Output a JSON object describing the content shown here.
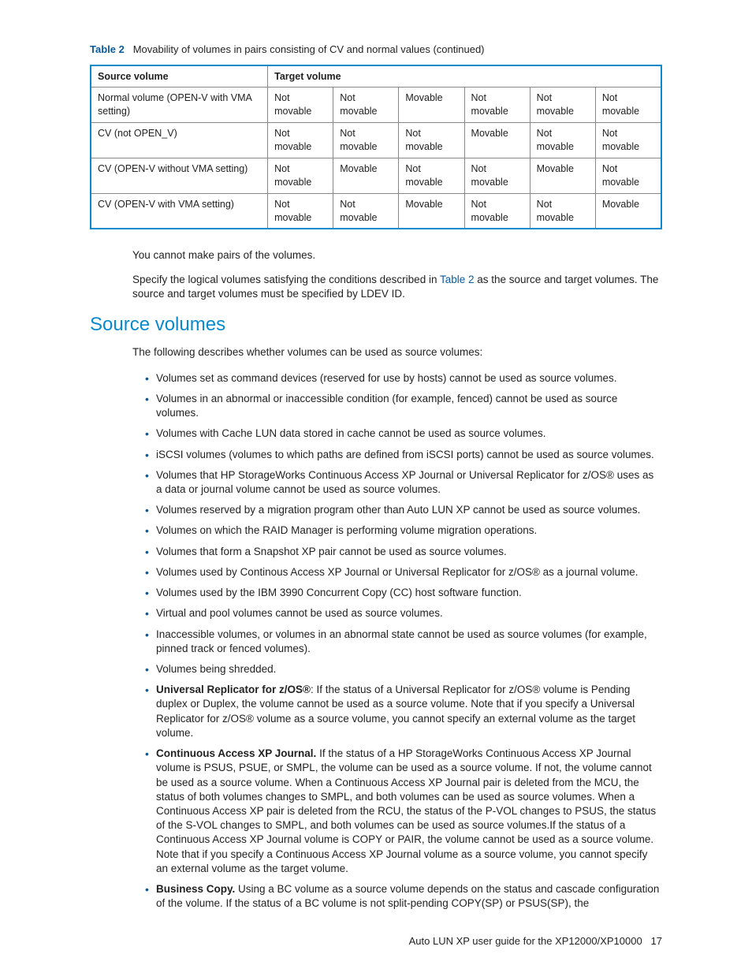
{
  "caption": {
    "label": "Table 2",
    "text": "Movability of volumes in pairs consisting of CV and normal values (continued)"
  },
  "table": {
    "headers": [
      "Source volume",
      "Target volume"
    ],
    "rows": [
      {
        "c0": "Normal volume (OPEN-V with VMA setting)",
        "c1": "Not movable",
        "c2": "Not movable",
        "c3": "Movable",
        "c4": "Not movable",
        "c5": "Not movable",
        "c6": "Not movable"
      },
      {
        "c0": "CV (not OPEN_V)",
        "c1": "Not movable",
        "c2": "Not movable",
        "c3": "Not movable",
        "c4": "Movable",
        "c5": "Not movable",
        "c6": "Not movable"
      },
      {
        "c0": "CV (OPEN-V without VMA setting)",
        "c1": "Not movable",
        "c2": "Movable",
        "c3": "Not movable",
        "c4": "Not movable",
        "c5": "Movable",
        "c6": "Not movable"
      },
      {
        "c0": "CV (OPEN-V with VMA setting)",
        "c1": "Not movable",
        "c2": "Not movable",
        "c3": "Movable",
        "c4": "Not movable",
        "c5": "Not movable",
        "c6": "Movable"
      }
    ]
  },
  "paras": {
    "p1": "You cannot make pairs of the volumes.",
    "p2a": "Specify the logical volumes satisfying the conditions described in ",
    "p2link": "Table 2",
    "p2b": " as the source and target volumes. The source and target volumes must be specified by LDEV ID."
  },
  "section_title": "Source volumes",
  "intro": "The following describes whether volumes can be used as source volumes:",
  "bullets": [
    {
      "text": "Volumes set as command devices (reserved for use by hosts) cannot be used as source volumes."
    },
    {
      "text": "Volumes in an abnormal or inaccessible condition (for example, fenced) cannot be used as source volumes."
    },
    {
      "text": "Volumes with Cache LUN data stored in cache cannot be used as source volumes."
    },
    {
      "text": "iSCSI volumes (volumes to which paths are defined from iSCSI ports) cannot be used as source volumes."
    },
    {
      "text": "Volumes that HP StorageWorks Continuous Access XP Journal or Universal Replicator for z/OS® uses as a data or journal volume cannot be used as source volumes."
    },
    {
      "text": "Volumes reserved by a migration program other than Auto LUN XP cannot be used as source volumes."
    },
    {
      "text": "Volumes on which the RAID Manager is performing volume migration operations."
    },
    {
      "text": "Volumes that form a Snapshot XP pair cannot be used as source volumes."
    },
    {
      "text": "Volumes used by Continous Access XP Journal or Universal Replicator for z/OS® as a journal volume."
    },
    {
      "text": "Volumes used by the IBM 3990 Concurrent Copy (CC) host software function."
    },
    {
      "text": "Virtual and pool volumes cannot be used as source volumes."
    },
    {
      "text": "Inaccessible volumes, or volumes in an abnormal state cannot be used as source volumes (for example, pinned track or fenced volumes)."
    },
    {
      "text": "Volumes being shredded."
    },
    {
      "bold": "Universal Replicator for z/OS®",
      "text": ": If the status of a Universal Replicator for z/OS® volume is Pending duplex or Duplex, the volume cannot be used as a source volume. Note that if you specify a Universal Replicator for z/OS® volume as a source volume, you cannot specify an external volume as the target volume."
    },
    {
      "bold": "Continuous Access XP Journal.",
      "text": " If the status of a HP StorageWorks Continuous Access XP Journal volume is PSUS, PSUE, or SMPL, the volume can be used as a source volume. If not, the volume cannot be used as a source volume. When a Continuous Access XP Journal pair is deleted from the MCU, the status of both volumes changes to SMPL, and both volumes can be used as source volumes. When a Continuous Access XP pair is deleted from the RCU, the status of the P-VOL changes to PSUS, the status of the S-VOL changes to SMPL, and both volumes can be used as source volumes.If the status of a Continuous Access XP Journal volume is COPY or PAIR, the volume cannot be used as a source volume. Note that if you specify a Continuous Access XP Journal volume as a source volume, you cannot specify an external volume as the target volume."
    },
    {
      "bold": "Business Copy.",
      "text": " Using a BC volume as a source volume depends on the status and cascade configuration of the volume. If the status of a BC volume is not split-pending COPY(SP) or PSUS(SP), the"
    }
  ],
  "footer": {
    "title": "Auto LUN XP user guide for the XP12000/XP10000",
    "page": "17"
  }
}
